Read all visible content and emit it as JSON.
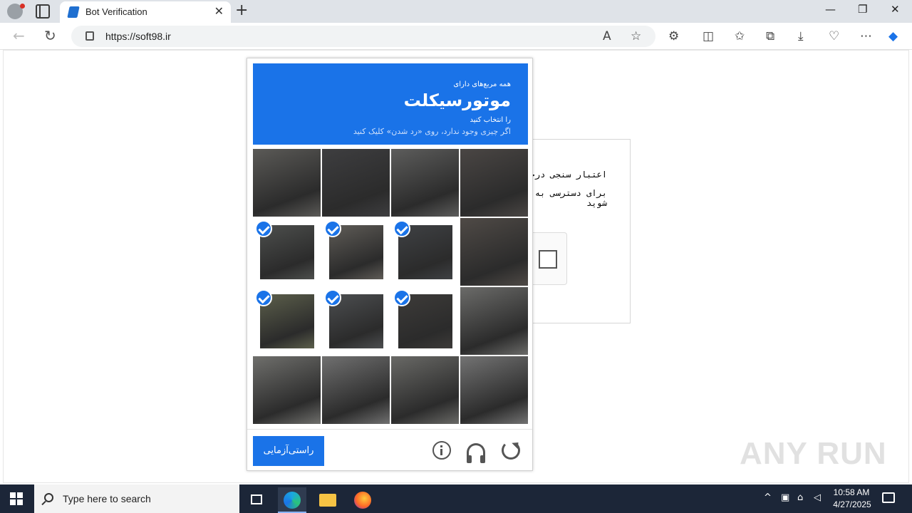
{
  "browser": {
    "tab_title": "Bot Verification",
    "tab_close": "✕",
    "new_tab": "+",
    "url": "https://soft98.ir",
    "window_controls": {
      "minimize": "—",
      "restore": "❐",
      "close": "✕"
    },
    "icons": [
      "back-icon",
      "refresh-icon",
      "read-aloud-icon",
      "favorite-icon",
      "extensions-icon",
      "split-screen-icon",
      "favorites-icon",
      "collections-icon",
      "downloads-icon",
      "browser-essentials-icon",
      "more-icon",
      "copilot-icon"
    ]
  },
  "background_card": {
    "line1": "اعتبار سنجی درخو",
    "line2": "برای دسترسی به",
    "line3": "شوید"
  },
  "captcha": {
    "prompt_small": "همه مربع‌های دارای",
    "prompt_target": "موتورسیکلت",
    "prompt_sub": "را انتخاب کنید",
    "prompt_hint": "اگر چیزی وجود ندارد، روی «رد شدن» کلیک کنید",
    "verify_label": "راستی‌آزمایی",
    "tiles": [
      {
        "selected": false,
        "color": "#5b5a57"
      },
      {
        "selected": false,
        "color": "#3e3e40"
      },
      {
        "selected": false,
        "color": "#5d5d5c"
      },
      {
        "selected": false,
        "color": "#4a4644"
      },
      {
        "selected": true,
        "color": "#4d4f4d"
      },
      {
        "selected": true,
        "color": "#5f5c57"
      },
      {
        "selected": true,
        "color": "#3f4144"
      },
      {
        "selected": false,
        "color": "#4f4a46"
      },
      {
        "selected": true,
        "color": "#5c5f4b"
      },
      {
        "selected": true,
        "color": "#4c4e50"
      },
      {
        "selected": true,
        "color": "#3d3b39"
      },
      {
        "selected": false,
        "color": "#6b6b69"
      },
      {
        "selected": false,
        "color": "#6f6f6c"
      },
      {
        "selected": false,
        "color": "#707070"
      },
      {
        "selected": false,
        "color": "#696966"
      },
      {
        "selected": false,
        "color": "#737373"
      }
    ],
    "accent": "#1a73e8"
  },
  "watermark": "ANY RUN",
  "taskbar": {
    "search_placeholder": "Type here to search",
    "time": "10:58 AM",
    "date": "4/27/2025",
    "tray_chevron": "^"
  }
}
